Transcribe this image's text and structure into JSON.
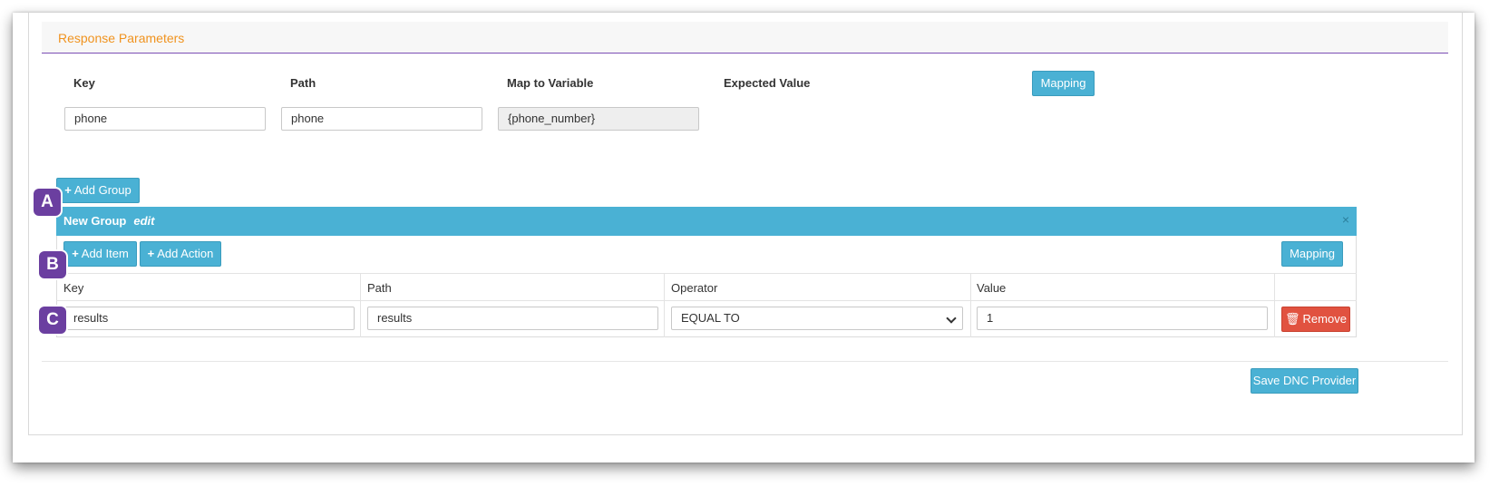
{
  "response_parameters": {
    "title": "Response Parameters",
    "columns": {
      "key": "Key",
      "path": "Path",
      "map_to_variable": "Map to Variable",
      "expected_value": "Expected Value"
    },
    "mapping_button": "Mapping",
    "row": {
      "key": "phone",
      "path": "phone",
      "map_to_variable": "{phone_number}"
    }
  },
  "add_group_button": "Add Group",
  "group": {
    "title": "New Group",
    "edit_label": "edit",
    "close_symbol": "×",
    "add_item_button": "Add Item",
    "add_action_button": "Add Action",
    "mapping_button": "Mapping",
    "columns": {
      "key": "Key",
      "path": "Path",
      "operator": "Operator",
      "value": "Value"
    },
    "row": {
      "key": "results",
      "path": "results",
      "operator": "EQUAL TO",
      "value": "1",
      "remove_button": "Remove"
    }
  },
  "save_button": "Save DNC Provider",
  "annotations": {
    "a": "A",
    "b": "B",
    "c": "C"
  },
  "colors": {
    "accent": "#4ab1d4",
    "danger": "#e15240",
    "title_orange": "#f0931f",
    "badge_purple": "#6b3fa0"
  },
  "icons": {
    "plus": "plus-icon",
    "trash": "trash-icon",
    "close": "close-icon",
    "caret": "chevron-down-icon"
  }
}
